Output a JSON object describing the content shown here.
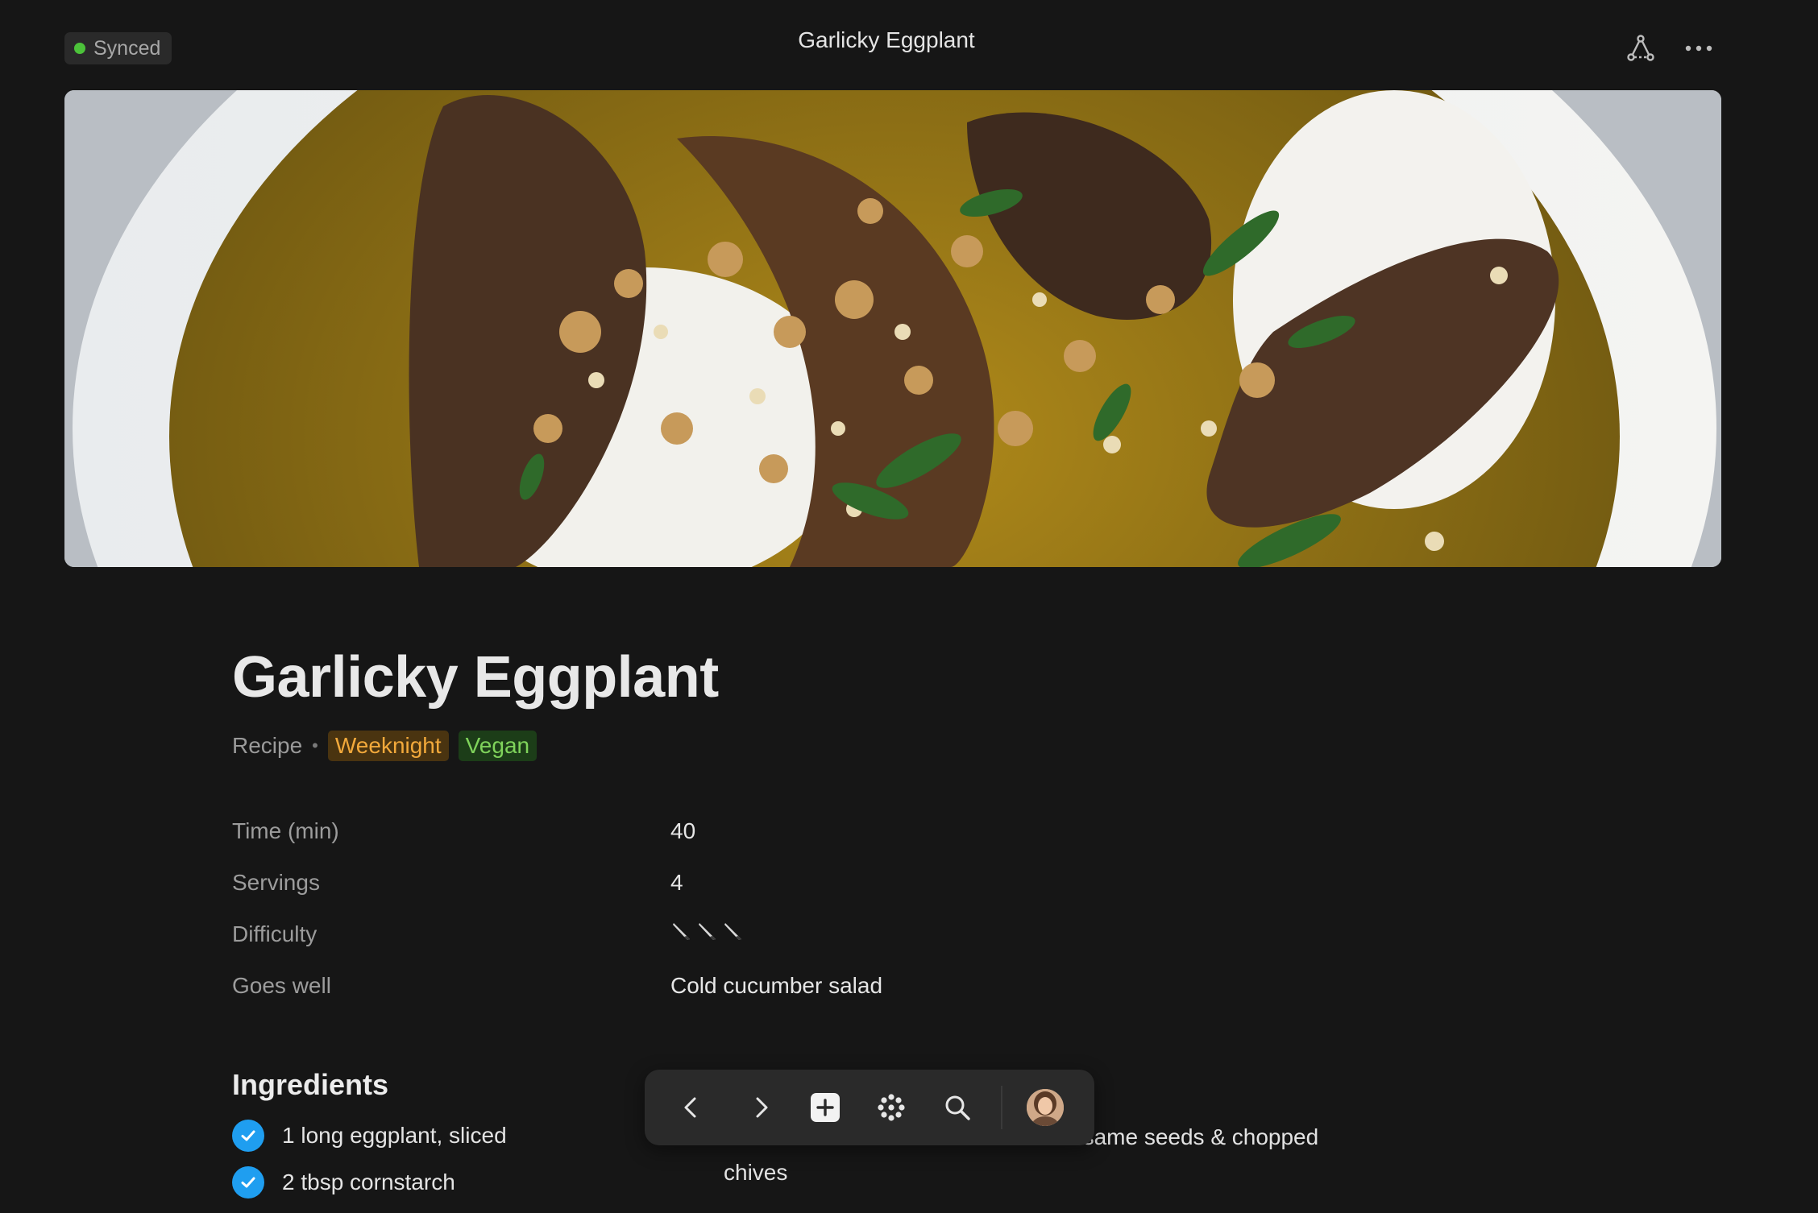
{
  "topbar": {
    "sync_status": "Synced",
    "window_title": "Garlicky Eggplant",
    "share_icon": "share-network-icon",
    "more_icon": "more-dots-icon"
  },
  "page": {
    "title": "Garlicky Eggplant",
    "type": "Recipe",
    "separator": "•",
    "tags": [
      {
        "label": "Weeknight",
        "color": "#f2a93b",
        "bg": "#4a3410"
      },
      {
        "label": "Vegan",
        "color": "#7fd35b",
        "bg": "#1c3d18"
      }
    ]
  },
  "properties": [
    {
      "label": "Time (min)",
      "value": "40"
    },
    {
      "label": "Servings",
      "value": "4"
    },
    {
      "label": "Difficulty",
      "value_icons": [
        "knife-icon",
        "knife-icon",
        "knife-icon"
      ],
      "rating": 3
    },
    {
      "label": "Goes well",
      "value": "Cold cucumber salad"
    }
  ],
  "ingredients": {
    "title": "Ingredients",
    "items": [
      {
        "text": "1 long eggplant, sliced",
        "checked": true
      },
      {
        "text": "2 tbsp cornstarch",
        "checked": true
      }
    ]
  },
  "steps": {
    "visible_text": "…same seeds & chopped chives",
    "line1_tail": "esame seeds & chopped",
    "line2": "chives"
  },
  "toolbar": {
    "back_icon": "chevron-left-icon",
    "forward_icon": "chevron-right-icon",
    "new_icon": "plus-square-icon",
    "home_icon": "flower-grid-icon",
    "search_icon": "search-icon",
    "avatar": "user-avatar"
  },
  "colors": {
    "background": "#161616",
    "accent_check": "#1f9ef0",
    "synced_dot": "#4cc23a"
  }
}
